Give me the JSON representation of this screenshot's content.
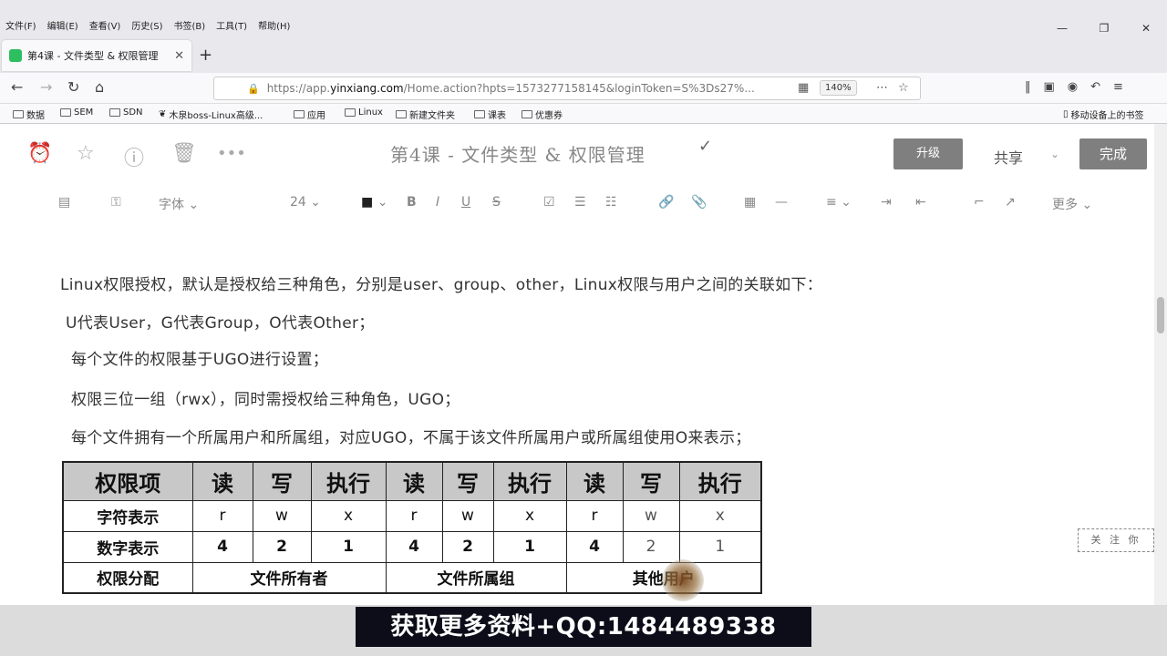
{
  "menu": [
    "文件(F)",
    "编辑(E)",
    "查看(V)",
    "历史(S)",
    "书签(B)",
    "工具(T)",
    "帮助(H)"
  ],
  "window_controls": {
    "minimize": "—",
    "restore": "❐",
    "close": "✕"
  },
  "tab": {
    "title": "第4课 - 文件类型 & 权限管理",
    "close": "✕"
  },
  "new_tab": "+",
  "address": {
    "scheme": "https://app.",
    "host": "yinxiang.com",
    "path": "/Home.action?hpts=1573277158145&loginToken=S%3Ds27%...",
    "zoom": "140%"
  },
  "bookmarks": [
    "数据",
    "SEM",
    "SDN",
    "木泉boss-Linux高级...",
    "应用",
    "Linux",
    "新建文件夹",
    "课表",
    "优惠券"
  ],
  "mobile_bookmarks": "移动设备上的书签",
  "note": {
    "title": "第4课 - 文件类型 & 权限管理",
    "upgrade": "升级",
    "share": "共享",
    "done": "完成"
  },
  "format": {
    "font": "字体",
    "size": "24",
    "more": "更多"
  },
  "paragraphs": [
    "Linux权限授权，默认是授权给三种角色，分别是user、group、other，Linux权限与用户之间的关联如下：",
    "U代表User，G代表Group，O代表Other；",
    "每个文件的权限基于UGO进行设置；",
    "权限三位一组（rwx），同时需授权给三种角色，UGO；",
    "每个文件拥有一个所属用户和所属组，对应UGO，不属于该文件所属用户或所属组使用O来表示；"
  ],
  "table": {
    "header": [
      "权限项",
      "读",
      "写",
      "执行",
      "读",
      "写",
      "执行",
      "读",
      "写",
      "执行"
    ],
    "rows": [
      {
        "label": "字符表示",
        "cells": [
          "r",
          "w",
          "x",
          "r",
          "w",
          "x",
          "r",
          "w",
          "x"
        ]
      },
      {
        "label": "数字表示",
        "cells": [
          "4",
          "2",
          "1",
          "4",
          "2",
          "1",
          "4",
          "2",
          "1"
        ]
      }
    ],
    "assign": {
      "label": "权限分配",
      "owner": "文件所有者",
      "group": "文件所属组",
      "other": "其他用户"
    }
  },
  "side_stamp": "关 注 你",
  "banner": "获取更多资料+QQ:1484489338"
}
